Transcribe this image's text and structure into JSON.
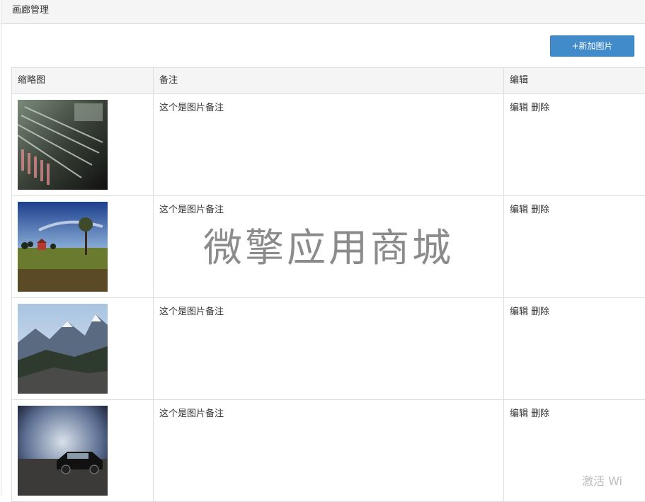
{
  "panel": {
    "title": "画廊管理"
  },
  "toolbar": {
    "add_label": "+新加图片"
  },
  "table": {
    "headers": {
      "thumbnail": "缩略图",
      "note": "备注",
      "edit": "编辑"
    },
    "rows": [
      {
        "thumb_icon": "typewriter-keys-image",
        "note": "这个是图片备注",
        "edit_label": "编辑",
        "delete_label": "删除"
      },
      {
        "thumb_icon": "red-barn-landscape-image",
        "note": "这个是图片备注",
        "edit_label": "编辑",
        "delete_label": "删除"
      },
      {
        "thumb_icon": "snowy-mountains-image",
        "note": "这个是图片备注",
        "edit_label": "编辑",
        "delete_label": "删除"
      },
      {
        "thumb_icon": "black-car-image",
        "note": "这个是图片备注",
        "edit_label": "编辑",
        "delete_label": "删除"
      }
    ]
  },
  "watermark": "微擎应用商城",
  "corner_text": "激活 Wi"
}
